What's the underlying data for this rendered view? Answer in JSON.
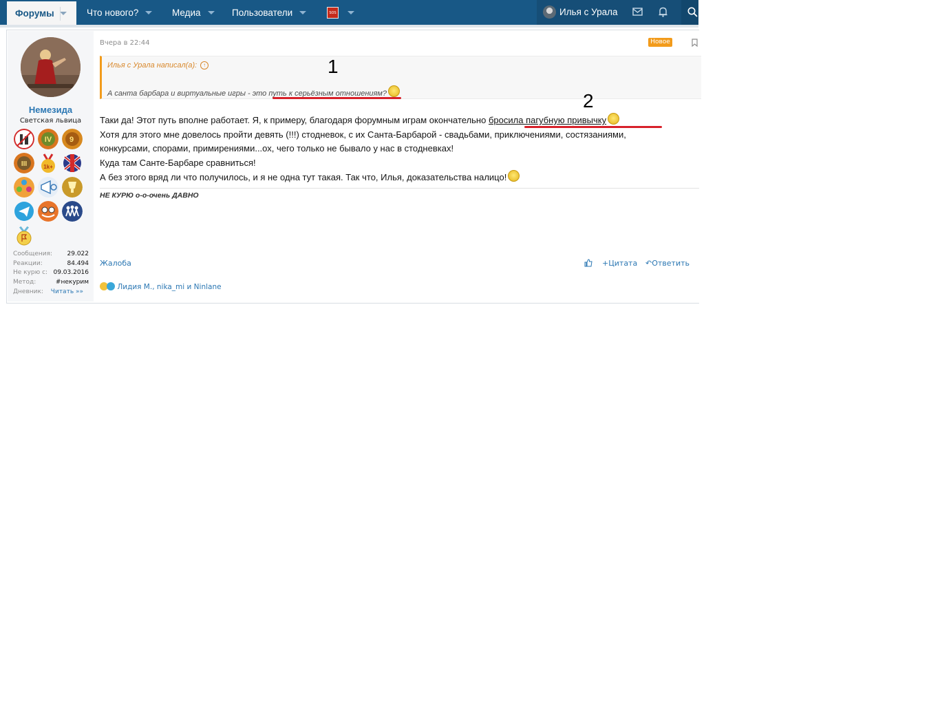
{
  "nav": {
    "forums": "Форумы",
    "whats_new": "Что нового?",
    "media": "Медиа",
    "users": "Пользователи",
    "sos_label": "SOS",
    "current_user": "Илья с Урала"
  },
  "post": {
    "date": "Вчера в 22:44",
    "new_badge": "Новое",
    "author": {
      "name": "Немезида",
      "title": "Светская львица",
      "stats": [
        {
          "label": "Сообщения:",
          "value": "29.022"
        },
        {
          "label": "Реакции:",
          "value": "84.494"
        },
        {
          "label": "Не курю с:",
          "value": "09.03.2016"
        },
        {
          "label": "Метод:",
          "value": "#некурим"
        },
        {
          "label": "Дневник:",
          "value": "Читать »»"
        }
      ]
    },
    "quote": {
      "author_line": "Илья с Урала написал(а):",
      "text": "А санта барбара и виртуальные игры - это путь к серьёзным отношениям?"
    },
    "annotations": {
      "one": "1",
      "two": "2"
    },
    "body": {
      "line1_start": "Таки да! Этот путь вполне работает. Я, к примеру, благодаря форумным играм окончательно ",
      "line1_underlined": "бросила пагубную привычку",
      "line2": "Хотя для этого мне довелось пройти девять (!!!) стодневок, с их Санта-Барбарой - свадьбами, приключениями, состязаниями,",
      "line3": "конкурсами, спорами, примирениями...ох, чего только не бывало у нас в стодневках!",
      "line4": "Куда там Санте-Барбаре сравниться!",
      "line5": "А без этого вряд ли что получилось, и я не одна тут такая. Так что, Илья, доказательства налицо!"
    },
    "signature": "НЕ КУРЮ о-о-очень ДАВНО",
    "actions": {
      "report": "Жалоба",
      "quote": "Цитата",
      "reply": "Ответить"
    },
    "reactions_text": "Лидия М., nika_mi и Ninlane"
  }
}
